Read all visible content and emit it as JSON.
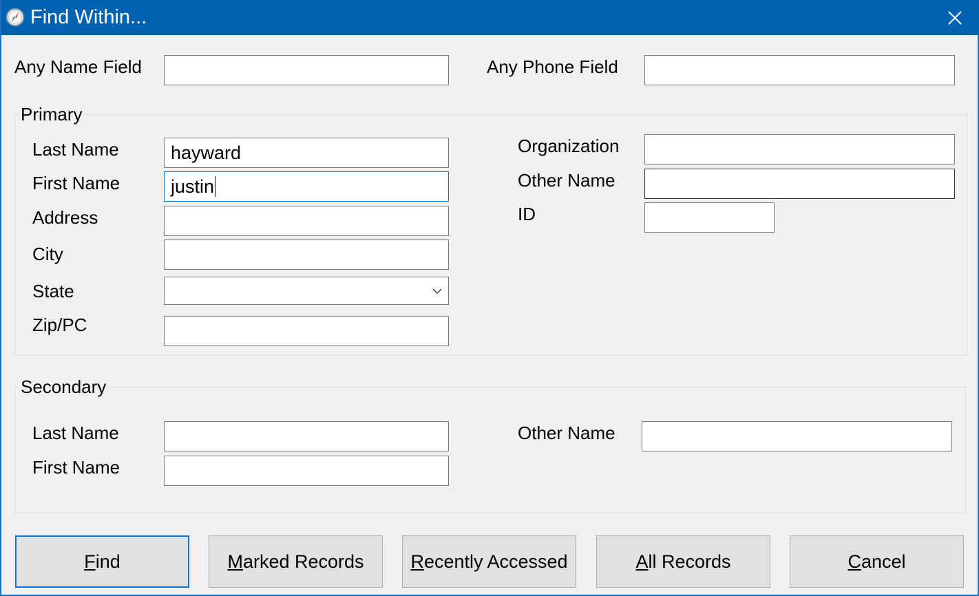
{
  "window": {
    "title": "Find Within...",
    "app_icon": "compass-icon",
    "close_icon": "close-icon"
  },
  "top": {
    "any_name_label": "Any Name Field",
    "any_name_value": "",
    "any_phone_label": "Any Phone Field",
    "any_phone_value": ""
  },
  "primary": {
    "title": "Primary",
    "last_name_label": "Last Name",
    "last_name_value": "hayward",
    "first_name_label": "First Name",
    "first_name_value": "justin",
    "address_label": "Address",
    "address_value": "",
    "city_label": "City",
    "city_value": "",
    "state_label": "State",
    "state_value": "",
    "zip_label": "Zip/PC",
    "zip_value": "",
    "organization_label": "Organization",
    "organization_value": "",
    "other_name_label": "Other Name",
    "other_name_value": "",
    "id_label": "ID",
    "id_value": ""
  },
  "secondary": {
    "title": "Secondary",
    "last_name_label": "Last Name",
    "last_name_value": "",
    "first_name_label": "First Name",
    "first_name_value": "",
    "other_name_label": "Other Name",
    "other_name_value": ""
  },
  "buttons": {
    "find": {
      "accel": "F",
      "rest": "ind"
    },
    "marked": {
      "accel": "M",
      "rest": "arked Records"
    },
    "recent": {
      "accel": "R",
      "rest": "ecently Accessed"
    },
    "all": {
      "accel": "A",
      "rest": "ll Records"
    },
    "cancel": {
      "accel": "C",
      "rest": "ancel"
    }
  },
  "colors": {
    "titlebar": "#0063b1",
    "focus": "#0078d7"
  }
}
